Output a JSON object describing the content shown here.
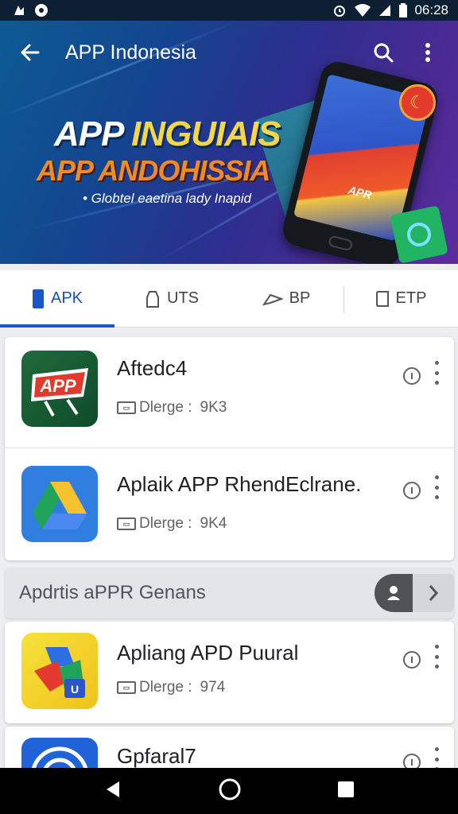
{
  "status_bar": {
    "time": "06:28"
  },
  "toolbar": {
    "title": "APP Indonesia"
  },
  "hero": {
    "line1_a": "APP ",
    "line1_b": "INGUIAIS",
    "line2": "APP ANDOHISSIA",
    "subtitle": "• Globtel eaetina lady Inapid",
    "phone_label": "APR"
  },
  "tabs": [
    {
      "label": "APK",
      "icon": "phone-icon",
      "active": true
    },
    {
      "label": "UTS",
      "icon": "bag-icon",
      "active": false
    },
    {
      "label": "BP",
      "icon": "send-icon",
      "active": false
    },
    {
      "label": "ETP",
      "icon": "document-icon",
      "active": false
    }
  ],
  "apps": [
    {
      "title": "Aftedc4",
      "meta_label": "Dlerge :",
      "meta_value": "9K3",
      "icon_text": "APP",
      "icon": "app-logo-icon"
    },
    {
      "title": "Aplaik APP RhendEclrane.",
      "meta_label": "Dlerge :",
      "meta_value": "9K4",
      "icon": "drive-icon"
    },
    {
      "title": "Apliang APD Puural",
      "meta_label": "Dlerge :",
      "meta_value": "974",
      "icon": "puzzle-app-icon"
    },
    {
      "title": "Gpfaral7",
      "icon": "target-app-icon"
    }
  ],
  "section": {
    "title": "Apdrtis aPPR Genans"
  },
  "colors": {
    "accent": "#1a56c4",
    "hero_start": "#0c5b93",
    "hero_end": "#5b2c9e"
  }
}
